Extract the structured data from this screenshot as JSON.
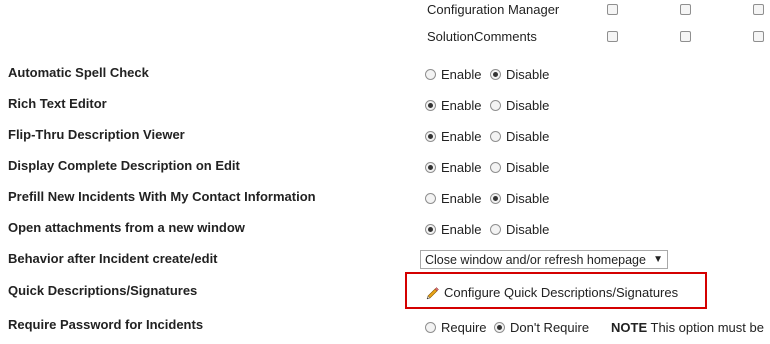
{
  "roles": [
    {
      "name": "Configuration Manager"
    },
    {
      "name": "SolutionComments"
    }
  ],
  "settings": {
    "spell_check": {
      "label": "Automatic Spell Check",
      "enable": "Enable",
      "disable": "Disable",
      "selected": "disable"
    },
    "rich_text": {
      "label": "Rich Text Editor",
      "enable": "Enable",
      "disable": "Disable",
      "selected": "enable"
    },
    "flip_thru": {
      "label": "Flip-Thru Description Viewer",
      "enable": "Enable",
      "disable": "Disable",
      "selected": "enable"
    },
    "display_complete": {
      "label": "Display Complete Description on Edit",
      "enable": "Enable",
      "disable": "Disable",
      "selected": "enable"
    },
    "prefill": {
      "label": "Prefill New Incidents With My Contact Information",
      "enable": "Enable",
      "disable": "Disable",
      "selected": "disable"
    },
    "attachments": {
      "label": "Open attachments from a new window",
      "enable": "Enable",
      "disable": "Disable",
      "selected": "enable"
    },
    "behavior": {
      "label": "Behavior after Incident create/edit",
      "value": "Close window and/or refresh homepage",
      "arrow": "▼"
    },
    "quick_desc": {
      "label": "Quick Descriptions/Signatures",
      "link": "Configure Quick Descriptions/Signatures",
      "icon": "pencil-icon"
    },
    "require_password": {
      "label": "Require Password for Incidents",
      "require": "Require",
      "dont_require": "Don't Require",
      "selected": "dont_require",
      "note_bold": "NOTE",
      "note_text": "This option must be"
    }
  }
}
